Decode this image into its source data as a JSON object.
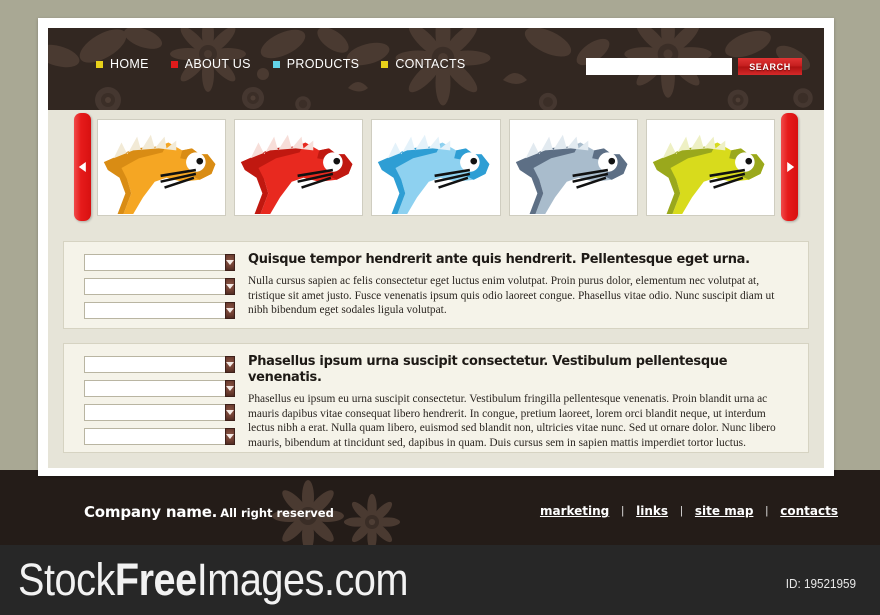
{
  "theme": {
    "page_background": "#a9a894",
    "header_background": "#322721",
    "panel_background": "#f5f3e9",
    "accent_red": "#d81010",
    "footer_background": "#241c18",
    "watermark_background": "#272727"
  },
  "header": {
    "nav": [
      {
        "label": "HOME",
        "bullet_icon": "square-bullet-icon",
        "bullet_color": "#e8d11a"
      },
      {
        "label": "ABOUT US",
        "bullet_icon": "square-bullet-icon",
        "bullet_color": "#e01b1b"
      },
      {
        "label": "PRODUCTS",
        "bullet_icon": "square-bullet-icon",
        "bullet_color": "#63d3e8"
      },
      {
        "label": "CONTACTS",
        "bullet_icon": "square-bullet-icon",
        "bullet_color": "#e8d11a"
      }
    ],
    "search": {
      "value": "",
      "placeholder": "",
      "button_label": "SEARCH",
      "icon": "search-icon"
    }
  },
  "carousel": {
    "prev_label": "◀",
    "next_label": "▶",
    "prev_icon": "chevron-left-icon",
    "next_icon": "chevron-right-icon",
    "slides": [
      {
        "name": "dragon-head-orange",
        "body": "#f5a623",
        "mane": "#f2ead6",
        "dark": "#d98c14",
        "neck": "#d98c14"
      },
      {
        "name": "dragon-head-red",
        "body": "#e8291f",
        "mane": "#f7ded9",
        "dark": "#c01810",
        "neck": "#c01810"
      },
      {
        "name": "dragon-head-blue",
        "body": "#8ed1f0",
        "mane": "#e4f2fa",
        "dark": "#2e9ed4",
        "neck": "#2e9ed4"
      },
      {
        "name": "dragon-head-grey",
        "body": "#a9bccc",
        "mane": "#e2eaf0",
        "dark": "#5d6f85",
        "neck": "#5d6f85"
      },
      {
        "name": "dragon-head-yellow",
        "body": "#d8db1c",
        "mane": "#eef0c4",
        "dark": "#9aa81c",
        "neck": "#9aa81c"
      }
    ]
  },
  "panels": [
    {
      "id": "panel-1",
      "heading": "Quisque tempor hendrerit ante quis hendrerit. Pellentesque eget urna.",
      "body": "Nulla cursus sapien ac felis consectetur eget luctus enim volutpat. Proin purus dolor, elementum nec volutpat at, tristique sit amet justo. Fusce venenatis ipsum quis odio laoreet congue. Phasellus vitae odio. Nunc suscipit diam ut nibh bibendum eget sodales ligula volutpat.",
      "fields": [
        {
          "name": "dropdown-1",
          "value": "",
          "placeholder": ""
        },
        {
          "name": "dropdown-2",
          "value": "",
          "placeholder": ""
        },
        {
          "name": "dropdown-3",
          "value": "",
          "placeholder": ""
        }
      ]
    },
    {
      "id": "panel-2",
      "heading": "Phasellus ipsum urna suscipit consectetur. Vestibulum pellentesque venenatis.",
      "body": "Phasellus eu ipsum eu urna suscipit consectetur. Vestibulum fringilla pellentesque venenatis. Proin blandit urna ac mauris dapibus vitae consequat libero hendrerit. In congue, pretium laoreet, lorem orci blandit neque, ut interdum lectus nibh a erat. Nulla quam libero, euismod sed blandit non, ultricies vitae nunc. Sed ut ornare dolor. Nunc libero mauris, bibendum at tincidunt sed, dapibus in quam. Duis cursus sem in sapien mattis imperdiet tortor luctus.",
      "fields": [
        {
          "name": "dropdown-1",
          "value": "",
          "placeholder": ""
        },
        {
          "name": "dropdown-2",
          "value": "",
          "placeholder": ""
        },
        {
          "name": "dropdown-3",
          "value": "",
          "placeholder": ""
        },
        {
          "name": "dropdown-4",
          "value": "",
          "placeholder": ""
        }
      ]
    }
  ],
  "footer": {
    "company_strong": "Company name.",
    "company_rest": "All right reserved",
    "separator": "|",
    "links": [
      {
        "label": "marketing"
      },
      {
        "label": "links"
      },
      {
        "label": "site map"
      },
      {
        "label": "contacts"
      }
    ]
  },
  "watermark": {
    "logo_prefix": "Stock",
    "logo_bold": "Free",
    "logo_suffix": "Images.com",
    "id_label": "ID: 19521959"
  }
}
